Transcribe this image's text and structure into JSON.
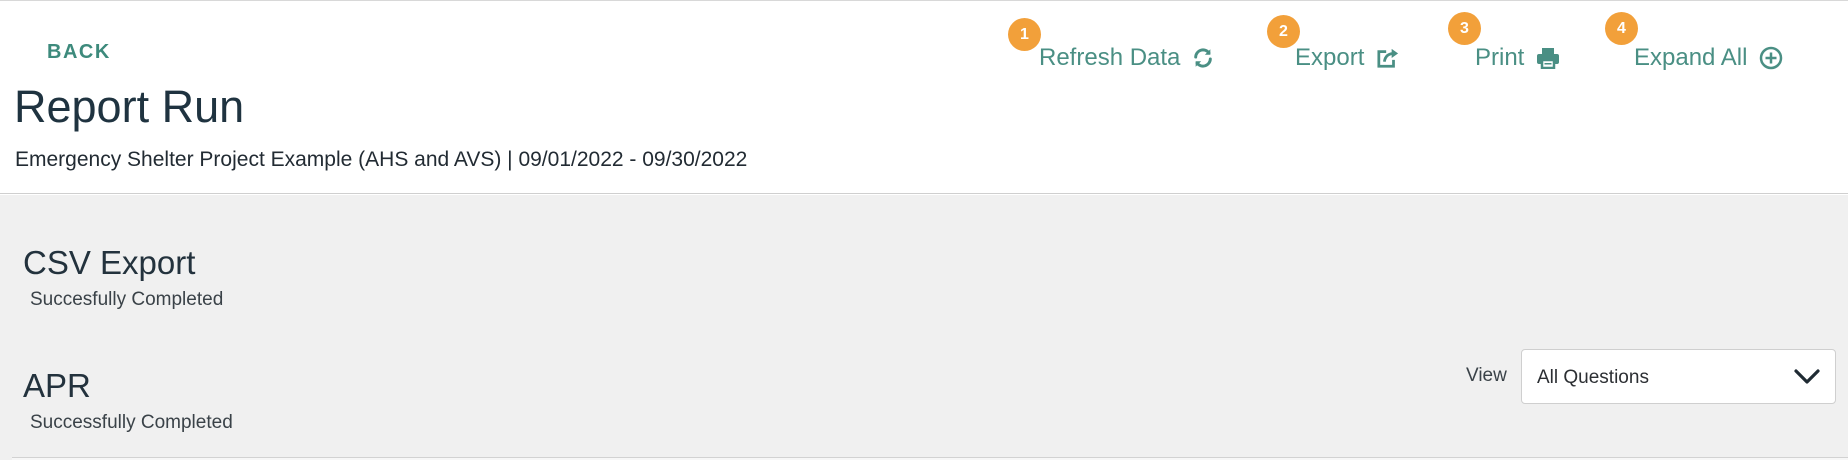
{
  "header": {
    "back_label": "BACK",
    "title": "Report Run",
    "subtitle": "Emergency Shelter Project Example (AHS and AVS) | 09/01/2022 - 09/30/2022"
  },
  "actions": [
    {
      "badge": "1",
      "label": "Refresh Data",
      "icon": "refresh-icon"
    },
    {
      "badge": "2",
      "label": "Export",
      "icon": "export-icon"
    },
    {
      "badge": "3",
      "label": "Print",
      "icon": "print-icon"
    },
    {
      "badge": "4",
      "label": "Expand All",
      "icon": "plus-circle-icon"
    }
  ],
  "sections": [
    {
      "title": "CSV Export",
      "status": "Succesfully Completed"
    },
    {
      "title": "APR",
      "status": "Successfully Completed"
    }
  ],
  "view": {
    "label": "View",
    "selected": "All Questions"
  },
  "colors": {
    "accent": "#4a8f84",
    "badge": "#f2a03a",
    "content_bg": "#f0f0f0",
    "title": "#1f3340"
  }
}
